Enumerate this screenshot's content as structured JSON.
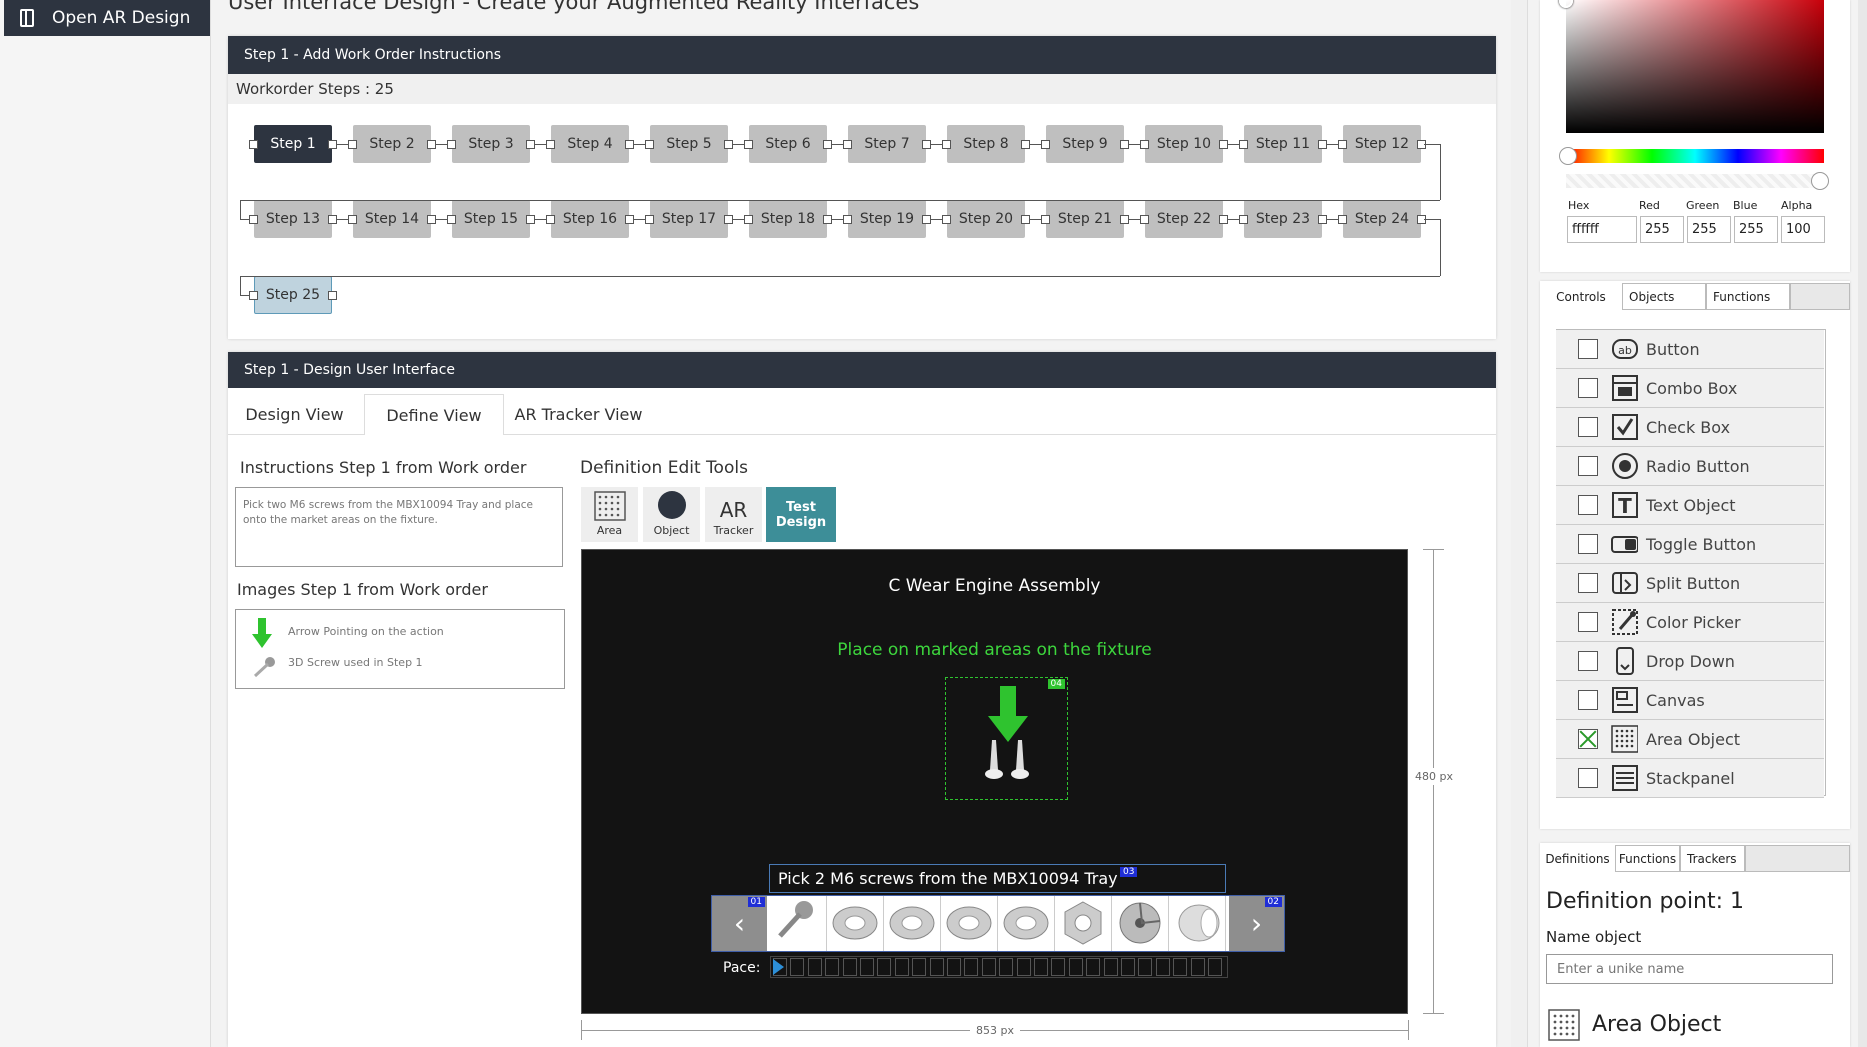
{
  "sidebar": {
    "open_label": "Open AR Design"
  },
  "page": {
    "title": "User Interface Design - Create your Augmented Reality Interfaces"
  },
  "workorder": {
    "header": "Step 1 - Add Work Order Instructions",
    "steps_label": "Workorder Steps : 25",
    "steps": [
      "Step 1",
      "Step 2",
      "Step 3",
      "Step 4",
      "Step 5",
      "Step 6",
      "Step 7",
      "Step 8",
      "Step 9",
      "Step 10",
      "Step 11",
      "Step 12",
      "Step 13",
      "Step 14",
      "Step 15",
      "Step 16",
      "Step 17",
      "Step 18",
      "Step 19",
      "Step 20",
      "Step 21",
      "Step 22",
      "Step 23",
      "Step 24",
      "Step 25"
    ]
  },
  "design": {
    "header": "Step 1 - Design User Interface",
    "tabs": [
      "Design View",
      "Define View",
      "AR Tracker View"
    ],
    "instructions_label": "Instructions  Step 1 from Work order",
    "instructions_text": "Pick two M6 screws from the MBX10094 Tray and place onto the market areas on the fixture.",
    "images_label": "Images Step 1 from Work order",
    "images": [
      "Arrow Pointing on the action",
      "3D Screw used in Step 1"
    ],
    "tools_label": "Definition Edit Tools",
    "tools": {
      "area": "Area",
      "object": "Object",
      "ar": "AR",
      "tracker": "Tracker",
      "test": "Test Design"
    },
    "canvas": {
      "title": "C Wear Engine Assembly",
      "subtitle": "Place on marked areas on the fixture",
      "badge_04": "04",
      "pick_text": "Pick 2 M6 screws from the MBX10094 Tray",
      "badge_03": "03",
      "badge_01": "01",
      "badge_02": "02",
      "pace_label": "Pace:",
      "height_label": "480 px",
      "width_label": "853 px"
    }
  },
  "color_picker": {
    "labels": {
      "hex": "Hex",
      "red": "Red",
      "green": "Green",
      "blue": "Blue",
      "alpha": "Alpha"
    },
    "values": {
      "hex": "ffffff",
      "red": "255",
      "green": "255",
      "blue": "255",
      "alpha": "100"
    }
  },
  "controls_panel": {
    "tabs": [
      "Controls",
      "Objects",
      "Functions"
    ],
    "items": [
      {
        "label": "Button",
        "checked": false,
        "icon": "button-icon"
      },
      {
        "label": "Combo Box",
        "checked": false,
        "icon": "combo-box-icon"
      },
      {
        "label": "Check Box",
        "checked": false,
        "icon": "check-box-icon"
      },
      {
        "label": "Radio Button",
        "checked": false,
        "icon": "radio-button-icon"
      },
      {
        "label": "Text Object",
        "checked": false,
        "icon": "text-object-icon"
      },
      {
        "label": "Toggle Button",
        "checked": false,
        "icon": "toggle-button-icon"
      },
      {
        "label": "Split Button",
        "checked": false,
        "icon": "split-button-icon"
      },
      {
        "label": "Color Picker",
        "checked": false,
        "icon": "color-picker-icon"
      },
      {
        "label": "Drop Down",
        "checked": false,
        "icon": "drop-down-icon"
      },
      {
        "label": "Canvas",
        "checked": false,
        "icon": "canvas-icon"
      },
      {
        "label": "Area Object",
        "checked": true,
        "icon": "area-object-icon"
      },
      {
        "label": "Stackpanel",
        "checked": false,
        "icon": "stackpanel-icon"
      }
    ]
  },
  "definitions_panel": {
    "tabs": [
      "Definitions",
      "Functions",
      "Trackers"
    ],
    "title": "Definition point: 1",
    "name_label": "Name object",
    "name_placeholder": "Enter a unike name",
    "object_type": "Area Object"
  }
}
